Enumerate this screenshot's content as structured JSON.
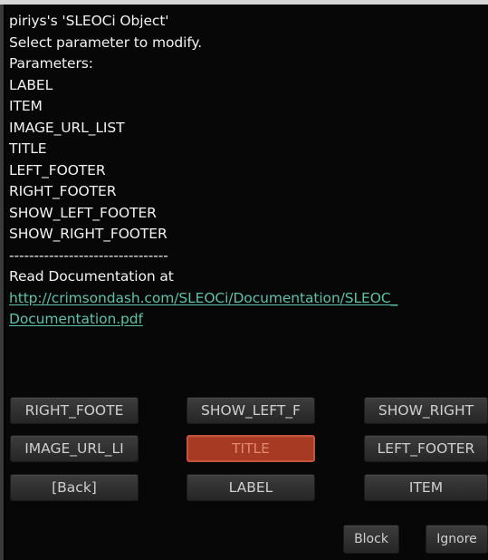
{
  "dialog": {
    "lines": [
      "piriys's 'SLEOCi Object'",
      "Select parameter to modify.",
      "Parameters:",
      "LABEL",
      "ITEM",
      "IMAGE_URL_LIST",
      "TITLE",
      "LEFT_FOOTER",
      "RIGHT_FOOTER",
      "SHOW_LEFT_FOOTER",
      "SHOW_RIGHT_FOOTER",
      "--------------------------------",
      "Read Documentation at"
    ],
    "link_lines": [
      "http://crimsondash.com/SLEOCi/Documentation/SLEOC_",
      "Documentation.pdf"
    ]
  },
  "buttons": {
    "row1": [
      "RIGHT_FOOTE",
      "SHOW_LEFT_F",
      "SHOW_RIGHT"
    ],
    "row2": [
      "IMAGE_URL_LI",
      "TITLE",
      "LEFT_FOOTER"
    ],
    "row3": [
      "[Back]",
      "LABEL",
      "ITEM"
    ],
    "selected": "TITLE",
    "block": "Block",
    "ignore": "Ignore"
  },
  "colors": {
    "background": "#070707",
    "text": "#f2f2f2",
    "link": "#5ec1a9",
    "button": "#303030",
    "selected_button": "#a63a22",
    "selected_text": "#e08a70"
  }
}
